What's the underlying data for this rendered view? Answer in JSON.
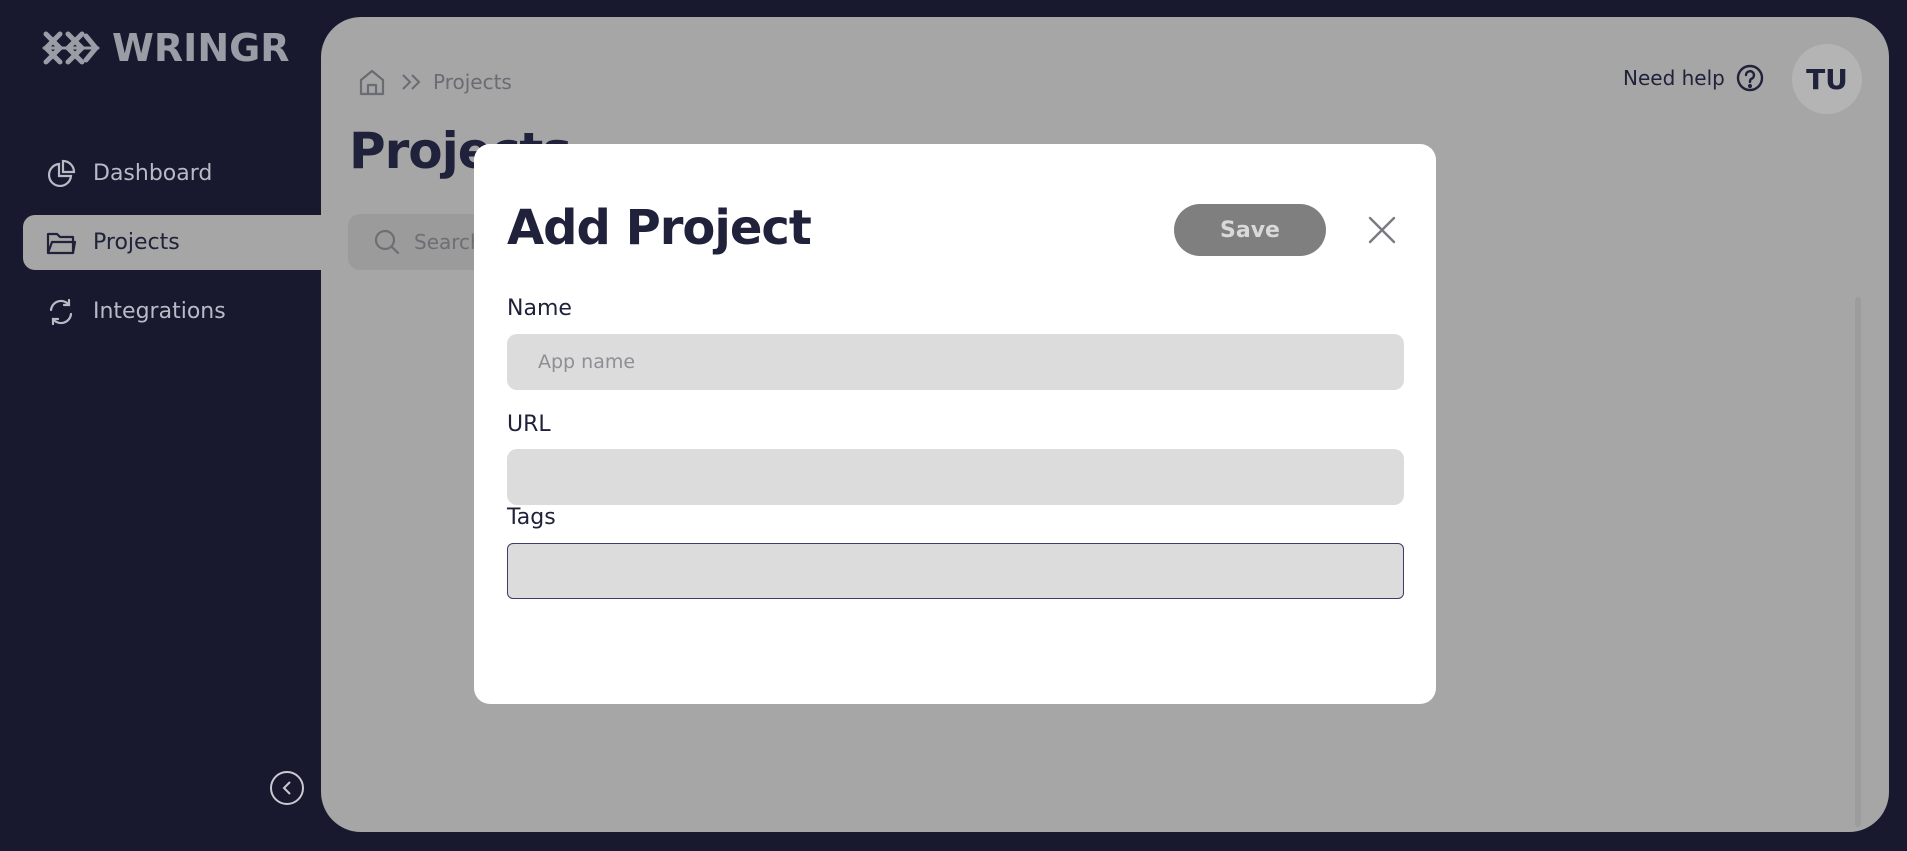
{
  "app": {
    "name": "WRINGR",
    "logo_icon": "wringr-logo-icon"
  },
  "sidebar": {
    "items": [
      {
        "label": "Dashboard",
        "icon": "pie-chart-icon",
        "active": false
      },
      {
        "label": "Projects",
        "icon": "folder-icon",
        "active": true
      },
      {
        "label": "Integrations",
        "icon": "refresh-icon",
        "active": false
      }
    ],
    "collapse_icon": "chevron-left-circle-icon"
  },
  "header": {
    "breadcrumb": {
      "home_icon": "home-icon",
      "separator_icon": "double-chevron-right-icon",
      "current": "Projects"
    },
    "need_help_label": "Need help",
    "help_icon": "question-circle-icon",
    "avatar_initials": "TU"
  },
  "main": {
    "page_title": "Projects",
    "search": {
      "placeholder": "Search",
      "icon": "search-icon"
    }
  },
  "modal": {
    "title": "Add Project",
    "save_label": "Save",
    "close_icon": "close-icon",
    "fields": [
      {
        "label": "Name",
        "placeholder": "App name",
        "value": ""
      },
      {
        "label": "URL",
        "placeholder": "",
        "value": ""
      },
      {
        "label": "Tags",
        "placeholder": "",
        "value": ""
      }
    ]
  },
  "colors": {
    "sidebar_bg": "#18182e",
    "panel_bg": "#a6a6a6",
    "text_dark": "#20213a",
    "save_button": "#7f7f7f",
    "input_bg": "#dcdcdc"
  }
}
